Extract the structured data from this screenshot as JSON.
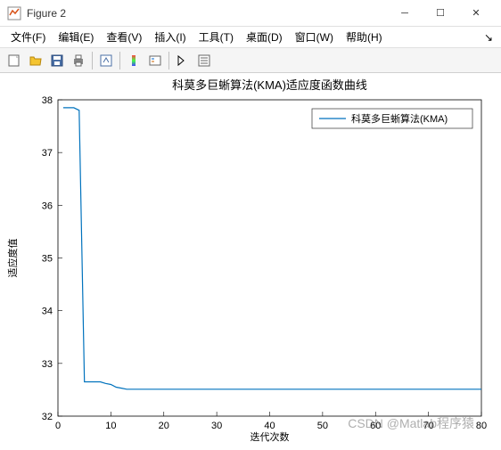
{
  "window": {
    "title": "Figure 2"
  },
  "menu": {
    "file": "文件(F)",
    "edit": "编辑(E)",
    "view": "查看(V)",
    "insert": "插入(I)",
    "tools": "工具(T)",
    "desktop": "桌面(D)",
    "window": "窗口(W)",
    "help": "帮助(H)"
  },
  "chart_data": {
    "type": "line",
    "title": "科莫多巨蜥算法(KMA)适应度函数曲线",
    "xlabel": "迭代次数",
    "ylabel": "适应度值",
    "xlim": [
      0,
      80
    ],
    "ylim": [
      32,
      38
    ],
    "xticks": [
      0,
      10,
      20,
      30,
      40,
      50,
      60,
      70,
      80
    ],
    "yticks": [
      32,
      33,
      34,
      35,
      36,
      37,
      38
    ],
    "legend": {
      "position": "upper-right",
      "entries": [
        "科莫多巨蜥算法(KMA)"
      ]
    },
    "series": [
      {
        "name": "科莫多巨蜥算法(KMA)",
        "color": "#0072bd",
        "x": [
          1,
          2,
          3,
          4,
          5,
          6,
          7,
          8,
          9,
          10,
          11,
          12,
          13,
          14,
          15,
          20,
          30,
          40,
          50,
          60,
          70,
          80
        ],
        "y": [
          37.85,
          37.85,
          37.85,
          37.8,
          32.65,
          32.65,
          32.65,
          32.65,
          32.62,
          32.6,
          32.55,
          32.53,
          32.51,
          32.51,
          32.51,
          32.51,
          32.51,
          32.51,
          32.51,
          32.51,
          32.51,
          32.51
        ]
      }
    ]
  },
  "watermark": "CSDN @Matlab程序猿"
}
